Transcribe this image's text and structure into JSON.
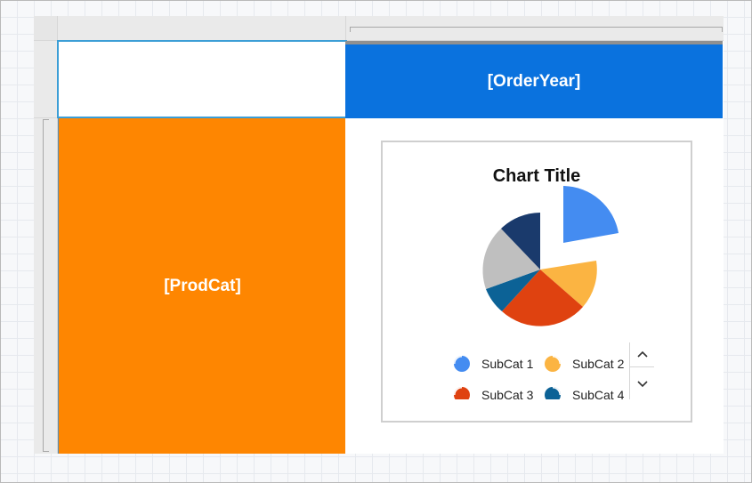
{
  "matrix": {
    "column_group_label": "[OrderYear]",
    "row_group_label": "[ProdCat]"
  },
  "chart": {
    "title": "Chart Title",
    "legend": [
      {
        "label": "SubCat 1",
        "color": "#448cf1"
      },
      {
        "label": "SubCat 2",
        "color": "#fbb442"
      },
      {
        "label": "SubCat 3",
        "color": "#df4210"
      },
      {
        "label": "SubCat 4",
        "color": "#0c6296"
      }
    ],
    "slice_colors": [
      "#448cf1",
      "#fbb442",
      "#df4210",
      "#0c6296",
      "#bfbfbf",
      "#1a3a6c"
    ],
    "exploded_slice": "SubCat 1"
  },
  "icons": {
    "legend_marker": "pie-slice-icon",
    "scroll_up": "chevron-up-icon",
    "scroll_down": "chevron-down-icon"
  }
}
